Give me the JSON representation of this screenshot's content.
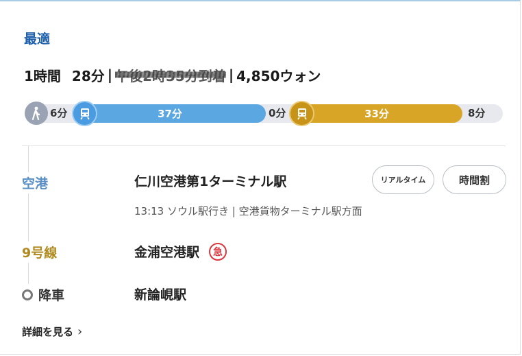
{
  "header": {
    "best_label": "最適"
  },
  "summary": {
    "hours": "1時間",
    "minutes": "28分",
    "sep1": "|",
    "arrival": "午後2時35分到着",
    "sep2": "|",
    "fare": "4,850ウォン"
  },
  "route_bar": {
    "walk_start": "6分",
    "segment1": "37分",
    "transfer": "0分",
    "segment2": "33分",
    "walk_end": "8分",
    "colors": {
      "segment1": "#5aa7e2",
      "segment2": "#d8a526",
      "walk": "#9aa3b3"
    }
  },
  "itinerary": {
    "airport_tag": "空港",
    "station1": "仁川空港第1ターミナル駅",
    "direction": "13:13 ソウル駅行き | 空港貨物ターミナル駅方面",
    "realtime_btn": "リアルタイム",
    "timetable_btn": "時間割",
    "line9_tag": "9号線",
    "station2": "金浦空港駅",
    "rapid_badge": "急",
    "getoff_tag": "降車",
    "station3": "新論峴駅"
  },
  "footer": {
    "details_link": "詳細を見る",
    "details_icon": "chevron-right-icon"
  }
}
